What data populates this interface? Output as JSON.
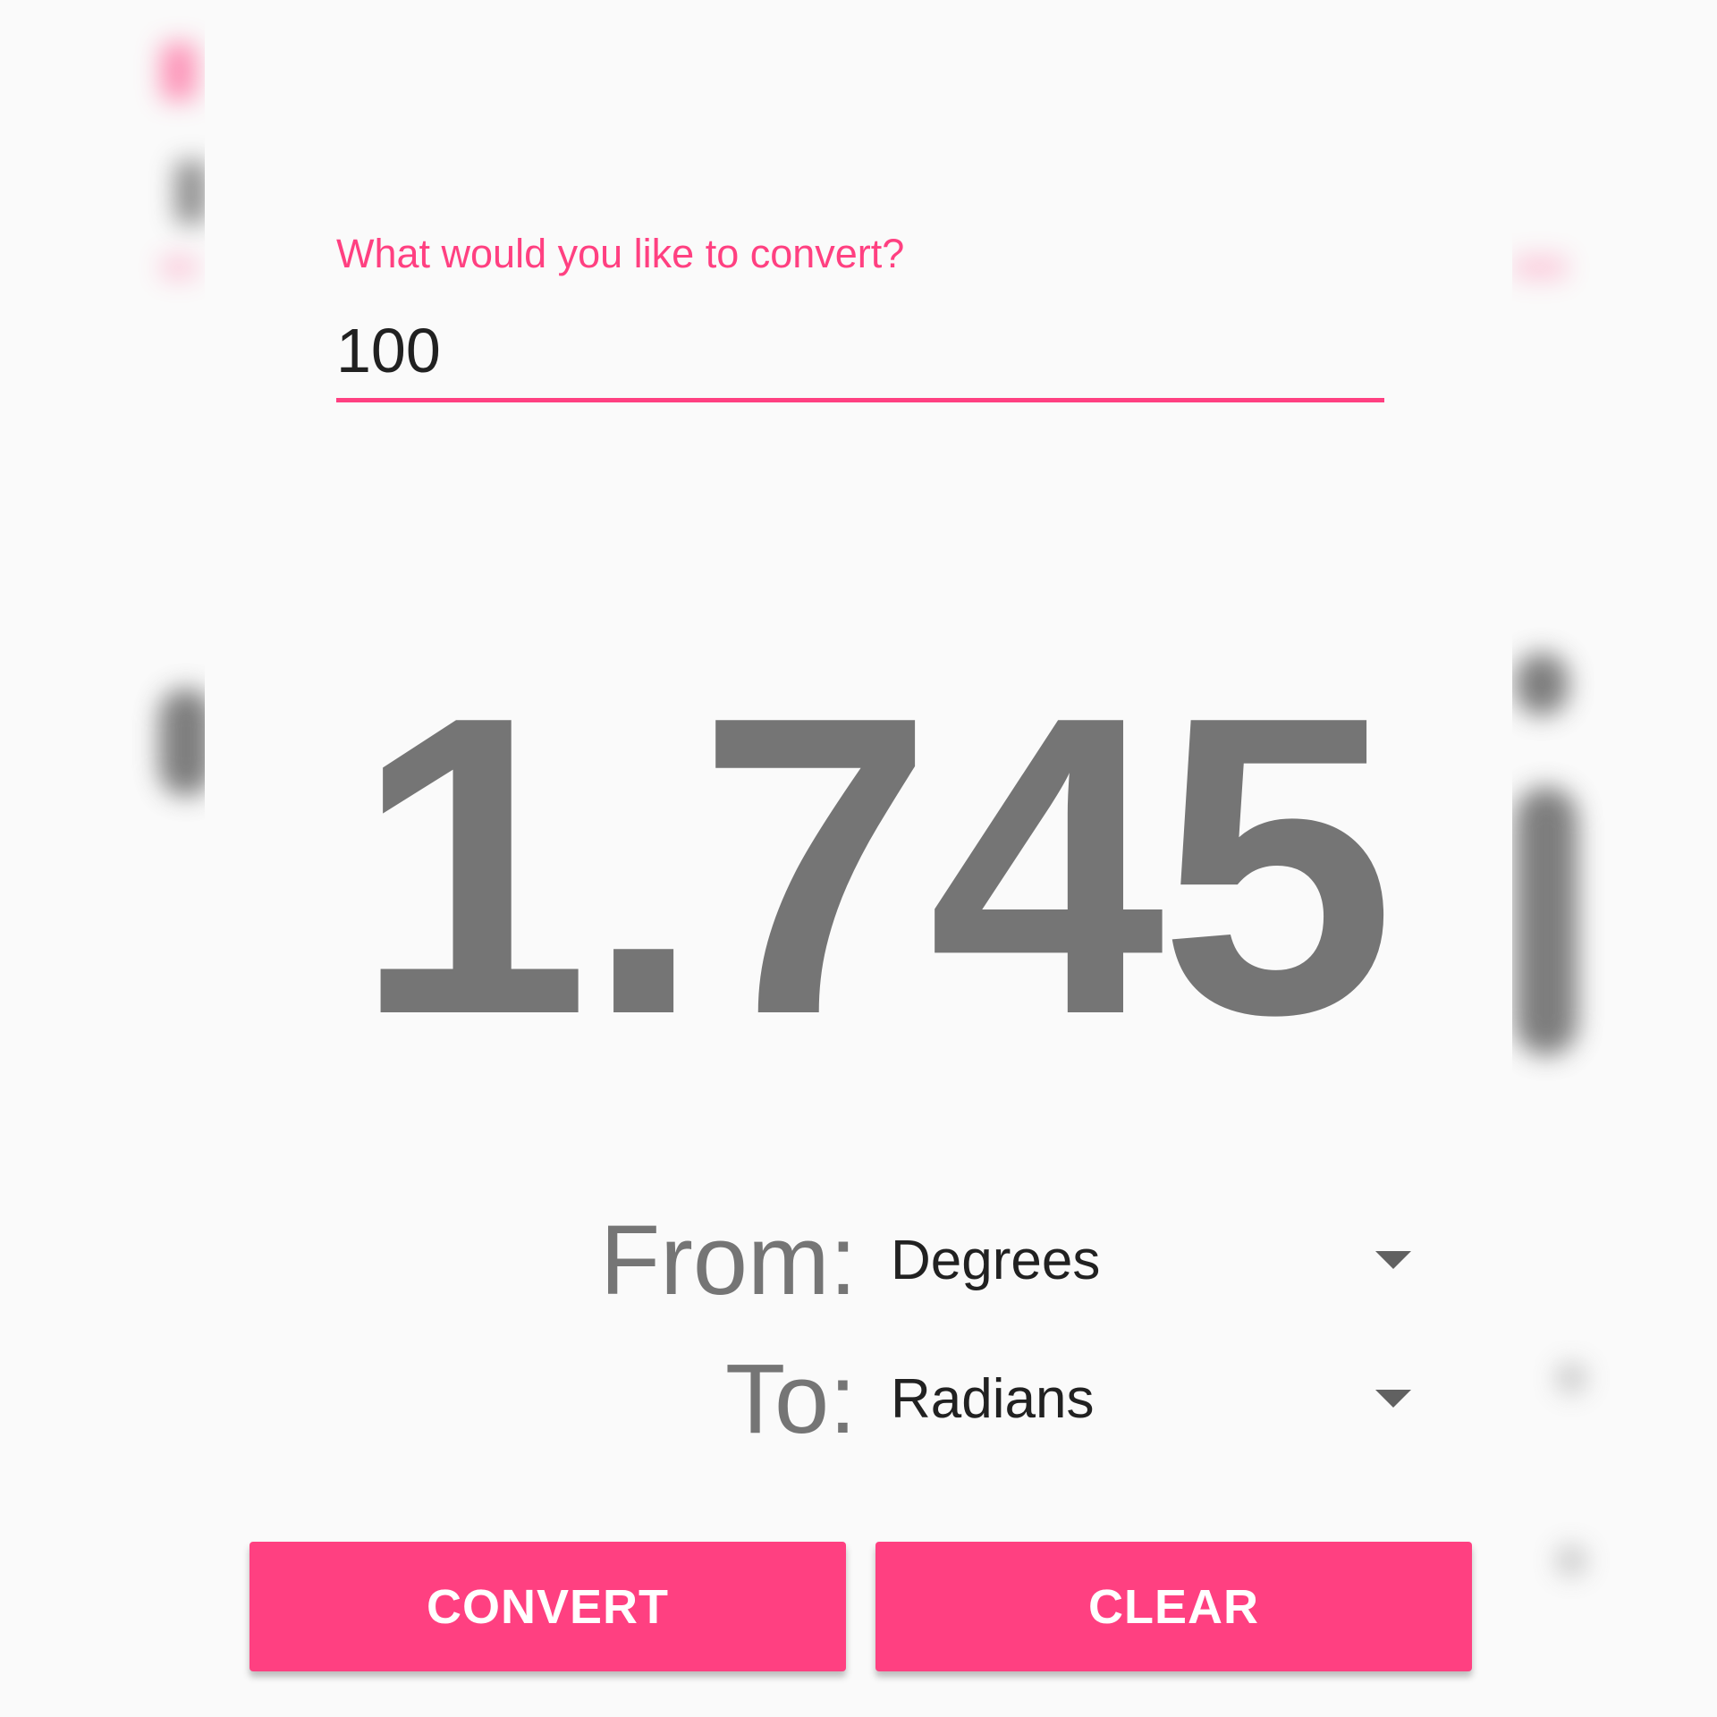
{
  "converter": {
    "prompt": "What would you like to convert?",
    "input_value": "100",
    "result": "1.745",
    "from_label": "From:",
    "from_value": "Degrees",
    "to_label": "To:",
    "to_value": "Radians"
  },
  "buttons": {
    "convert_label": "CONVERT",
    "clear_label": "CLEAR"
  },
  "icons": {
    "dropdown": "chevron-down-icon"
  },
  "colors": {
    "accent": "#ff4081",
    "result_text": "#757575",
    "background": "#fafafa"
  }
}
